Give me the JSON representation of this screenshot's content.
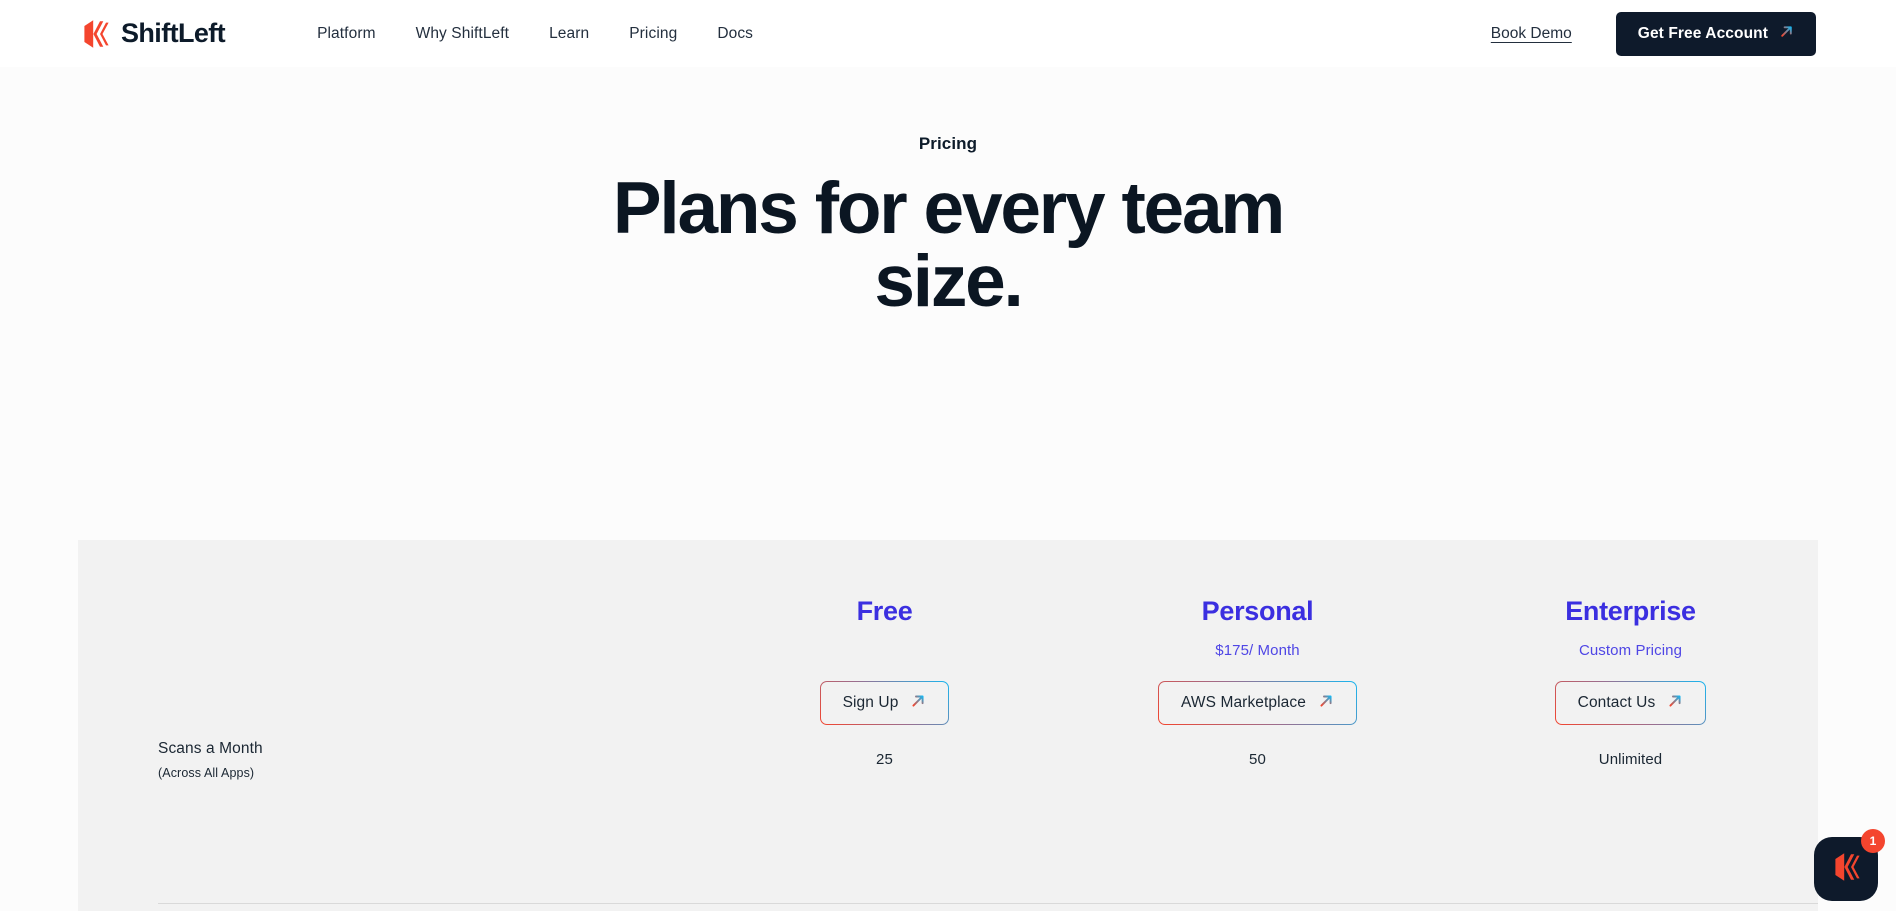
{
  "header": {
    "logo_text": "ShiftLeft",
    "logo_icon": "shiftleft-chevrons-icon",
    "nav": [
      {
        "label": "Platform"
      },
      {
        "label": "Why ShiftLeft"
      },
      {
        "label": "Learn"
      },
      {
        "label": "Pricing"
      },
      {
        "label": "Docs"
      }
    ],
    "book_demo_label": "Book Demo",
    "cta_label": "Get Free Account",
    "cta_icon": "arrow-up-right-icon"
  },
  "hero": {
    "eyebrow": "Pricing",
    "title": "Plans for every team size."
  },
  "pricing": {
    "plans": [
      {
        "name": "Free",
        "price": "",
        "button_label": "Sign Up",
        "button_icon": "arrow-up-right-icon"
      },
      {
        "name": "Personal",
        "price": "$175/ Month",
        "button_label": "AWS Marketplace",
        "button_icon": "arrow-up-right-icon"
      },
      {
        "name": "Enterprise",
        "price": "Custom Pricing",
        "button_label": "Contact Us",
        "button_icon": "arrow-up-right-icon"
      }
    ],
    "features": [
      {
        "title": "Scans a Month",
        "subtitle": "(Across All Apps)",
        "values": [
          "25",
          "50",
          "Unlimited"
        ]
      }
    ]
  },
  "chat": {
    "badge_count": "1",
    "icon": "shiftleft-chevrons-icon"
  },
  "colors": {
    "brand_red": "#F4452E",
    "brand_navy": "#0E1A2B",
    "plan_purple": "#3B2FE0",
    "price_purple": "#4F46E5",
    "panel_bg": "#F2F2F2"
  }
}
